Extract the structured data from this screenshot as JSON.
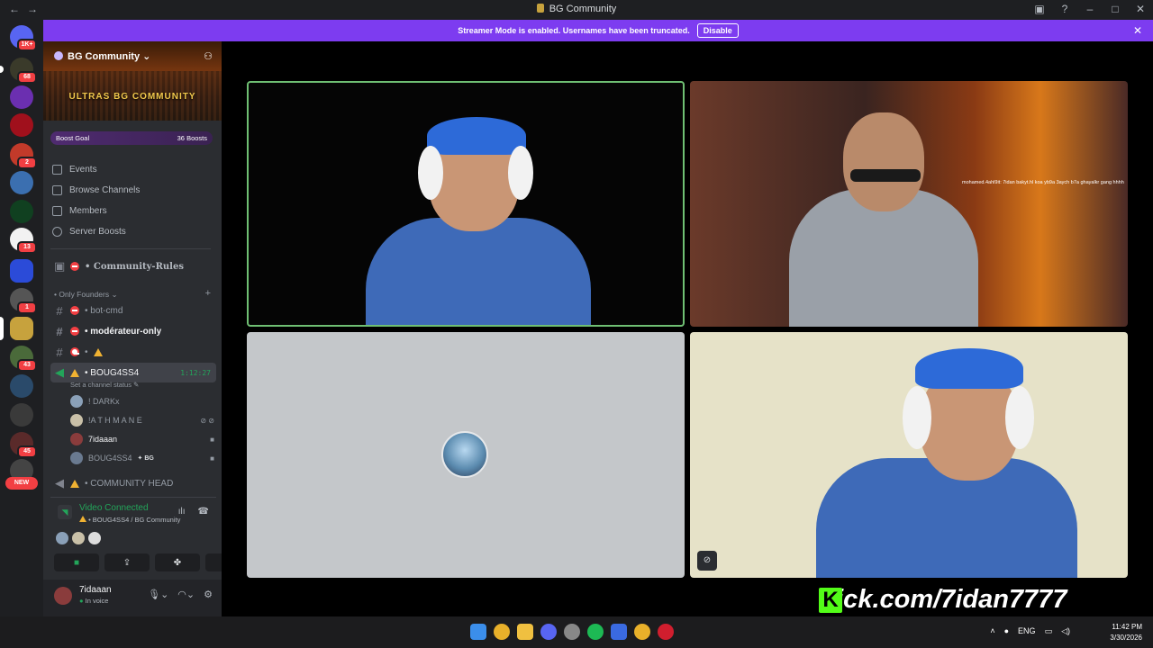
{
  "window": {
    "title": "BG Community"
  },
  "banner": {
    "text": "Streamer Mode is enabled. Usernames have been truncated.",
    "disable_label": "Disable"
  },
  "server_list": {
    "home_badge": "1K+",
    "badges": [
      "68",
      "2",
      "13",
      "1",
      "43",
      "45"
    ],
    "new_label": "NEW"
  },
  "server": {
    "name": "BG Community",
    "banner_text": "ULTRAS BG COMMUNITY",
    "boost_goal_label": "Boost Goal",
    "boost_count": "36 Boosts"
  },
  "menu": [
    {
      "label": "Events",
      "icon": "calendar-icon"
    },
    {
      "label": "Browse Channels",
      "icon": "browse-icon"
    },
    {
      "label": "Members",
      "icon": "members-icon"
    },
    {
      "label": "Server Boosts",
      "icon": "boost-icon"
    }
  ],
  "channels": {
    "rules": "• Community-Rules",
    "category": "• Only Founders",
    "bot_cmd": "• bot-cmd",
    "moderateur": "• modérateur-only",
    "voice_active": "• BOUG4SS4",
    "voice_timer": "1:12:27",
    "set_status": "Set a channel status",
    "voice_users": [
      {
        "name": "! DARKx"
      },
      {
        "name": "!A T H M A N E"
      },
      {
        "name": "7idaaan"
      },
      {
        "name": "BOUG4SS4",
        "tag": "BG"
      }
    ],
    "community_head": "• COMMUNITY HEAD"
  },
  "rtc": {
    "status": "Video Connected",
    "location": "• BOUG4SS4 / BG Community"
  },
  "user": {
    "name": "7idaaan",
    "status": "In voice"
  },
  "stream": {
    "chat_overlay": "mohamed.4ahl9it: 7idan bakyt.hl koa yb9a 3aych b7a ghayalkr gang hhhh",
    "kick_url": "kick.com/7idan7777"
  },
  "taskbar": {
    "lang": "ENG",
    "time": "11:42 PM",
    "date": "3/30/2026"
  },
  "colors": {
    "accent": "#7d3cf0",
    "connected": "#23a55a",
    "danger": "#f23f43",
    "kick": "#53fc18"
  }
}
